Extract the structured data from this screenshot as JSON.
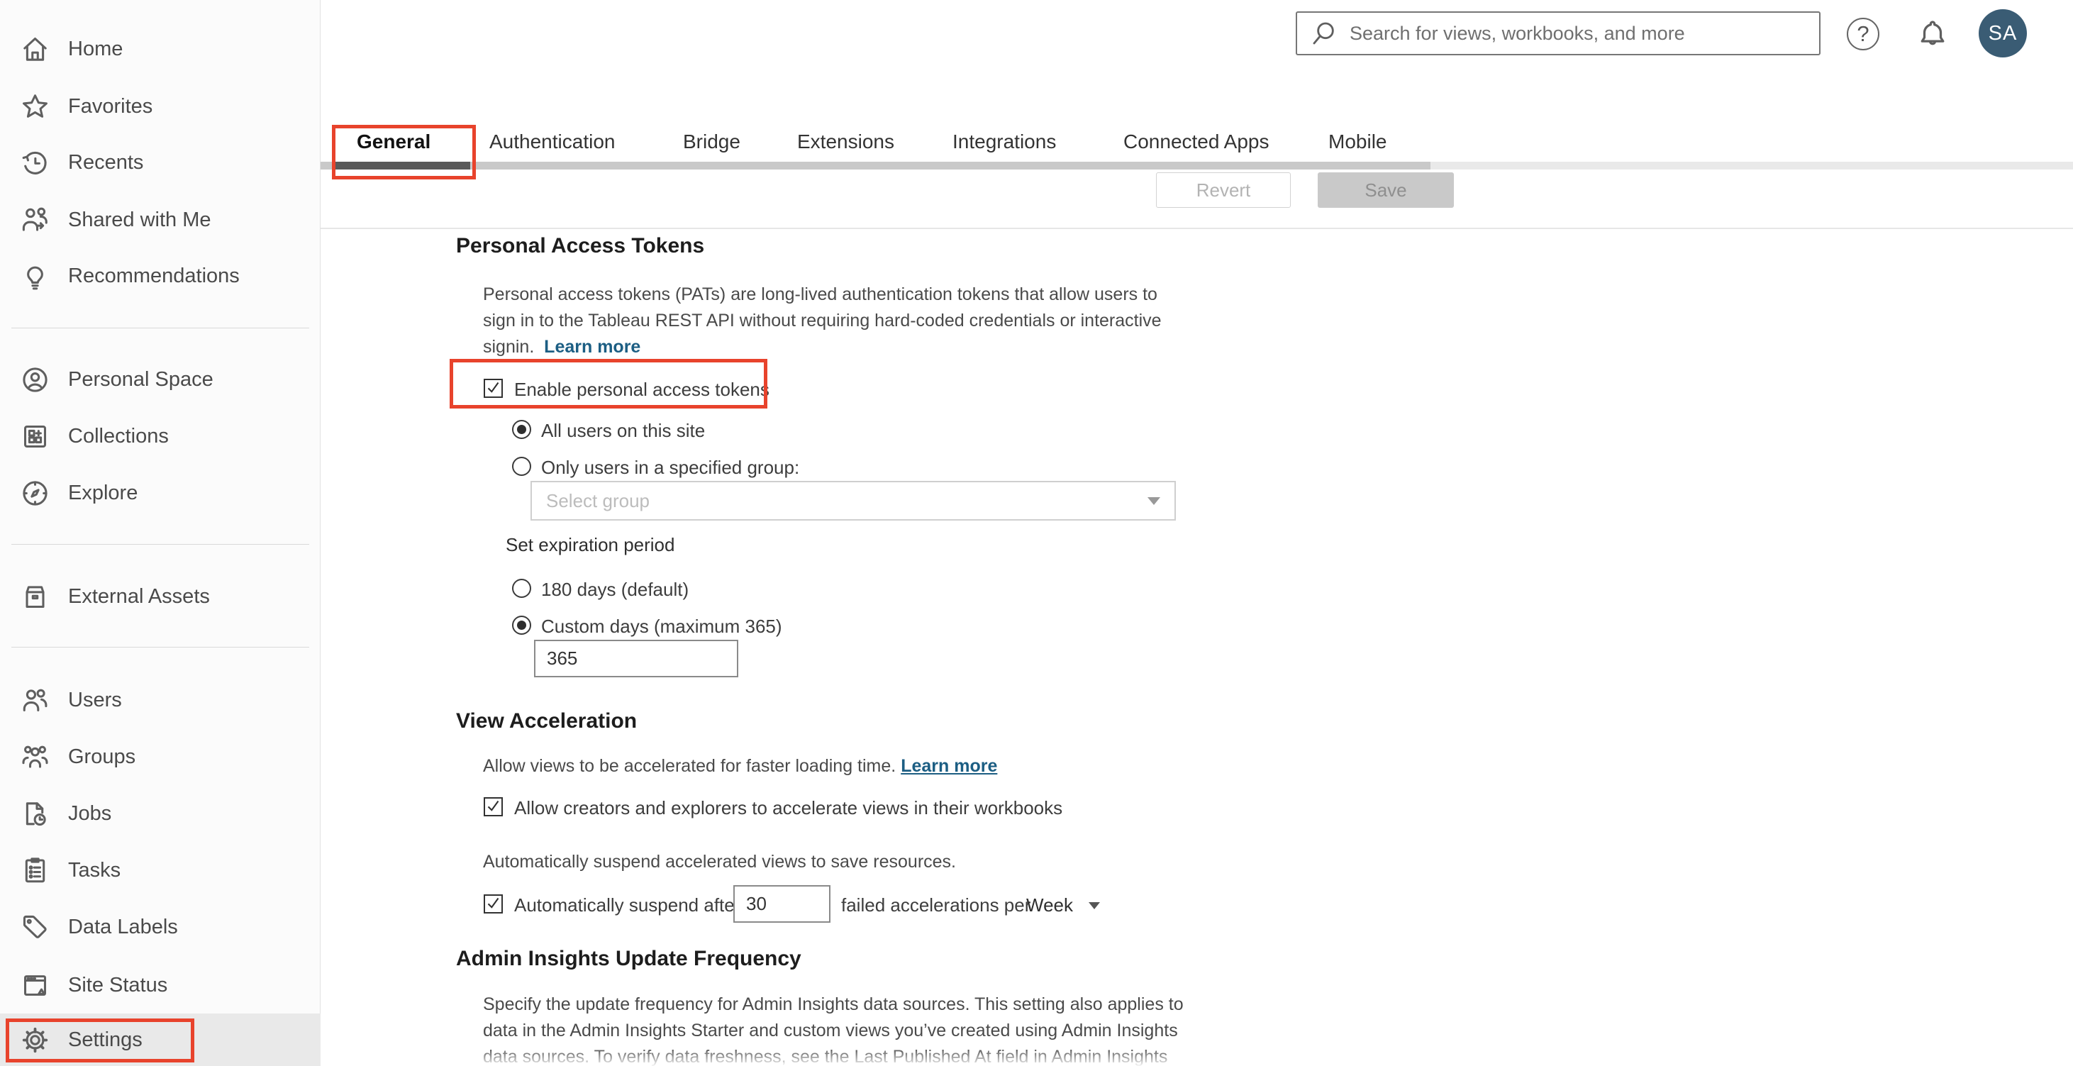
{
  "header": {
    "search_placeholder": "Search for views, workbooks, and more",
    "avatar_initials": "SA"
  },
  "sidebar": {
    "selected": "Settings",
    "items": [
      {
        "label": "Home",
        "icon": "home-icon"
      },
      {
        "label": "Favorites",
        "icon": "star-icon"
      },
      {
        "label": "Recents",
        "icon": "recents-icon"
      },
      {
        "label": "Shared with Me",
        "icon": "shared-with-me-icon"
      },
      {
        "label": "Recommendations",
        "icon": "lightbulb-icon"
      },
      {
        "label": "Personal Space",
        "icon": "person-circle-icon"
      },
      {
        "label": "Collections",
        "icon": "collections-icon"
      },
      {
        "label": "Explore",
        "icon": "compass-icon"
      },
      {
        "label": "External Assets",
        "icon": "external-assets-icon"
      },
      {
        "label": "Users",
        "icon": "users-icon"
      },
      {
        "label": "Groups",
        "icon": "groups-icon"
      },
      {
        "label": "Jobs",
        "icon": "jobs-icon"
      },
      {
        "label": "Tasks",
        "icon": "tasks-icon"
      },
      {
        "label": "Data Labels",
        "icon": "tag-icon"
      },
      {
        "label": "Site Status",
        "icon": "site-status-icon"
      },
      {
        "label": "Settings",
        "icon": "gear-icon"
      }
    ]
  },
  "tabs": {
    "active": "General",
    "items": [
      {
        "label": "General"
      },
      {
        "label": "Authentication"
      },
      {
        "label": "Bridge"
      },
      {
        "label": "Extensions"
      },
      {
        "label": "Integrations"
      },
      {
        "label": "Connected Apps"
      },
      {
        "label": "Mobile"
      }
    ]
  },
  "toolbar": {
    "revert_label": "Revert",
    "save_label": "Save"
  },
  "pat": {
    "title": "Personal Access Tokens",
    "description_lines": [
      "Personal access tokens (PATs) are long-lived authentication tokens that allow users to",
      "sign in to the Tableau REST API without requiring hard-coded credentials or interactive",
      "signin."
    ],
    "learn_more_label": "Learn more",
    "enable_checkbox_label": "Enable personal access tokens",
    "enable_checkbox_checked": true,
    "radio_all_users_label": "All users on this site",
    "radio_all_users_checked": true,
    "radio_group_label": "Only users in a specified group:",
    "radio_group_checked": false,
    "group_select_placeholder": "Select group",
    "expiration_label": "Set expiration period",
    "radio_default_label": "180 days (default)",
    "radio_default_checked": false,
    "radio_custom_label": "Custom days (maximum 365)",
    "radio_custom_checked": true,
    "custom_days_value": "365"
  },
  "view_acceleration": {
    "title": "View Acceleration",
    "description": "Allow views to be accelerated for faster loading time.",
    "learn_more_label": "Learn more",
    "allow_checkbox_label": "Allow creators and explorers to accelerate views in their workbooks",
    "allow_checkbox_checked": true,
    "suspend_intro": "Automatically suspend accelerated views to save resources.",
    "suspend_checkbox_label": "Automatically suspend after",
    "suspend_checkbox_checked": true,
    "suspend_threshold_value": "30",
    "suspend_suffix": "failed accelerations per",
    "period_select_value": "Week"
  },
  "admin_insights": {
    "title": "Admin Insights Update Frequency",
    "description_lines": [
      "Specify the update frequency for Admin Insights data sources. This setting also applies to",
      "data in the Admin Insights Starter and custom views you’ve created using Admin Insights",
      "data sources. To verify data freshness, see the Last Published At field in Admin Insights"
    ]
  },
  "colors": {
    "annotation_red": "#e8432c",
    "link_blue": "#1c5e83",
    "avatar_bg": "#3a5c74",
    "scrollbar_thumb": "#595959",
    "selected_row_bg": "#e9e9e9"
  }
}
